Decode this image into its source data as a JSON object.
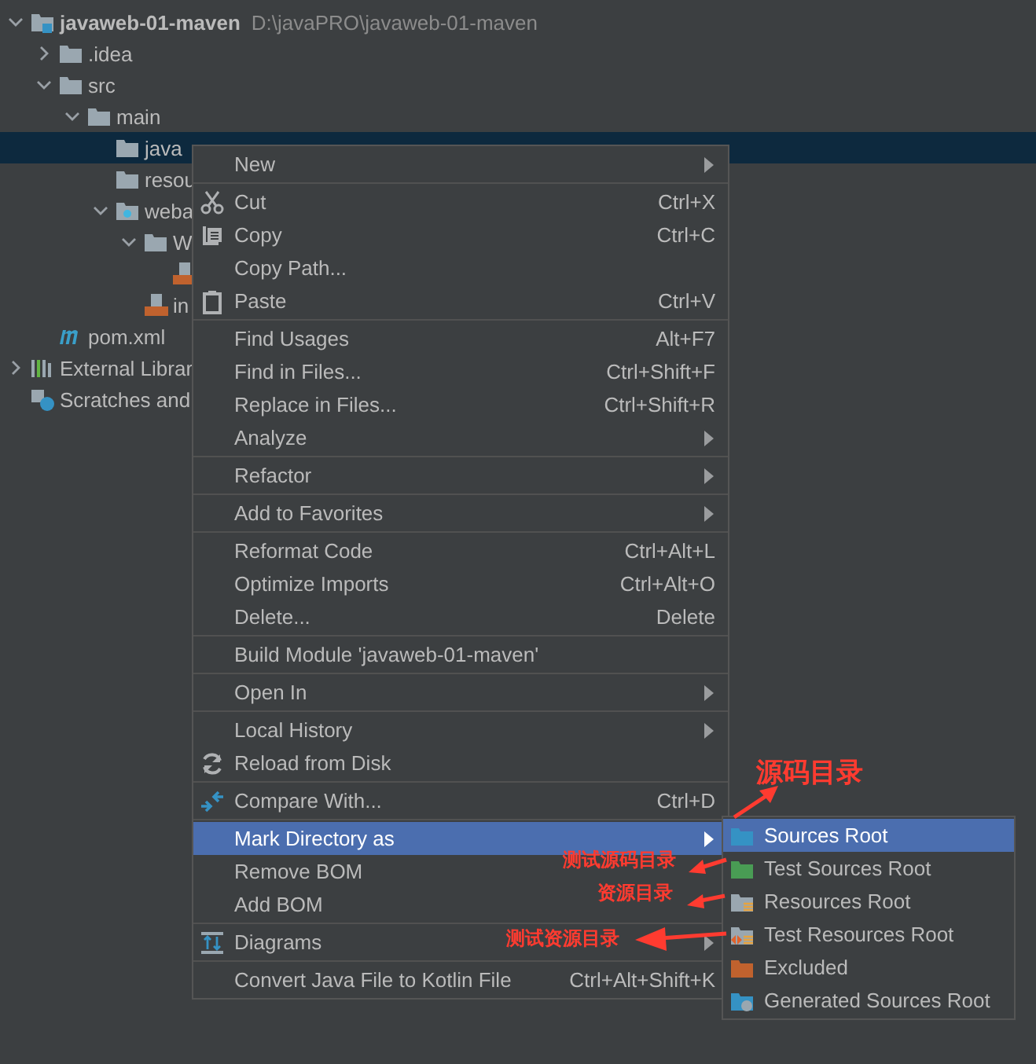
{
  "tree": [
    {
      "kind": "module",
      "label": "javaweb-01-maven",
      "path": "D:\\javaPRO\\javaweb-01-maven",
      "expanded": true,
      "selected": false,
      "children": [
        {
          "kind": "folder",
          "label": ".idea",
          "expanded": false,
          "selected": false
        },
        {
          "kind": "folder",
          "label": "src",
          "expanded": true,
          "selected": false,
          "children": [
            {
              "kind": "folder",
              "label": "main",
              "expanded": true,
              "selected": false,
              "children": [
                {
                  "kind": "folder",
                  "label": "java",
                  "selected": true
                },
                {
                  "kind": "folder",
                  "label": "resou",
                  "selected": false
                },
                {
                  "kind": "web",
                  "label": "weba",
                  "expanded": true,
                  "selected": false,
                  "children": [
                    {
                      "kind": "folder",
                      "label": "W",
                      "expanded": true,
                      "selected": false,
                      "children": [
                        {
                          "kind": "xmlfile",
                          "selected": false
                        }
                      ]
                    },
                    {
                      "kind": "jsp",
                      "label": "in",
                      "selected": false
                    }
                  ]
                }
              ]
            }
          ]
        },
        {
          "kind": "maven",
          "label": "pom.xml",
          "selected": false
        }
      ]
    },
    {
      "kind": "libraries",
      "label": "External Librar",
      "expanded": false,
      "selected": false
    },
    {
      "kind": "scratches",
      "label": "Scratches and",
      "selected": false
    }
  ],
  "menu": [
    [
      {
        "label": "New",
        "submenu": true,
        "selected": false
      }
    ],
    [
      {
        "label": "Cut",
        "shortcut": "Ctrl+X",
        "kind": "scissors",
        "selected": false
      },
      {
        "label": "Copy",
        "shortcut": "Ctrl+C",
        "kind": "copy",
        "selected": false
      },
      {
        "label": "Copy Path...",
        "selected": false
      },
      {
        "label": "Paste",
        "shortcut": "Ctrl+V",
        "kind": "paste",
        "selected": false
      }
    ],
    [
      {
        "label": "Find Usages",
        "shortcut": "Alt+F7",
        "selected": false
      },
      {
        "label": "Find in Files...",
        "shortcut": "Ctrl+Shift+F",
        "selected": false
      },
      {
        "label": "Replace in Files...",
        "shortcut": "Ctrl+Shift+R",
        "selected": false
      },
      {
        "label": "Analyze",
        "submenu": true,
        "selected": false
      }
    ],
    [
      {
        "label": "Refactor",
        "submenu": true,
        "selected": false
      }
    ],
    [
      {
        "label": "Add to Favorites",
        "submenu": true,
        "selected": false
      }
    ],
    [
      {
        "label": "Reformat Code",
        "shortcut": "Ctrl+Alt+L",
        "selected": false
      },
      {
        "label": "Optimize Imports",
        "shortcut": "Ctrl+Alt+O",
        "selected": false
      },
      {
        "label": "Delete...",
        "shortcut": "Delete",
        "selected": false
      }
    ],
    [
      {
        "label": "Build Module 'javaweb-01-maven'",
        "selected": false
      }
    ],
    [
      {
        "label": "Open In",
        "submenu": true,
        "selected": false
      }
    ],
    [
      {
        "label": "Local History",
        "submenu": true,
        "selected": false
      },
      {
        "label": "Reload from Disk",
        "kind": "reload",
        "selected": false
      }
    ],
    [
      {
        "label": "Compare With...",
        "shortcut": "Ctrl+D",
        "kind": "compare",
        "selected": false
      }
    ],
    [
      {
        "label": "Mark Directory as",
        "submenu": true,
        "selected": true
      },
      {
        "label": "Remove BOM",
        "selected": false
      },
      {
        "label": "Add BOM",
        "selected": false
      }
    ],
    [
      {
        "label": "Diagrams",
        "submenu": true,
        "kind": "diagram",
        "selected": false
      }
    ],
    [
      {
        "label": "Convert Java File to Kotlin File",
        "shortcut": "Ctrl+Alt+Shift+K",
        "selected": false
      }
    ]
  ],
  "submenu": [
    {
      "label": "Sources Root",
      "kind": "folder",
      "color": "#3592c4",
      "selected": true
    },
    {
      "label": "Test Sources Root",
      "kind": "folder",
      "color": "#499c54",
      "selected": false
    },
    {
      "label": "Resources Root",
      "kind": "resources",
      "color": "#9aa7b0",
      "selected": false
    },
    {
      "label": "Test Resources Root",
      "kind": "test-resources",
      "color": "#9aa7b0",
      "selected": false
    },
    {
      "label": "Excluded",
      "kind": "folder",
      "color": "#c0622e",
      "selected": false
    },
    {
      "label": "Generated Sources Root",
      "kind": "generated",
      "color": "#3592c4",
      "selected": false
    }
  ],
  "annotations": [
    {
      "text": "源码目录"
    },
    {
      "text": "测试源码目录"
    },
    {
      "text": "资源目录"
    },
    {
      "text": "测试资源目录"
    }
  ]
}
